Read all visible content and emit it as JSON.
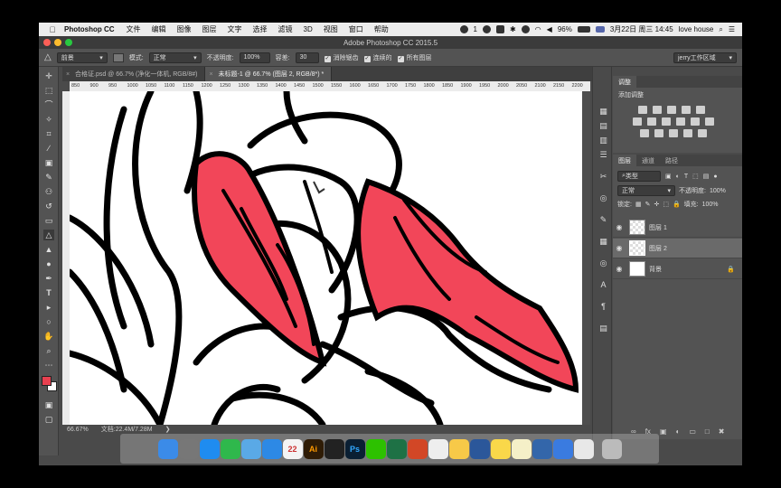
{
  "menubar": {
    "app_name": "Photoshop CC",
    "items": [
      "文件",
      "编辑",
      "图像",
      "图层",
      "文字",
      "选择",
      "滤镜",
      "3D",
      "视图",
      "窗口",
      "帮助"
    ],
    "wechat_count": "1",
    "battery": "96%",
    "datetime": "3月22日 周三 14:45",
    "user": "love house"
  },
  "titlebar": {
    "title": "Adobe Photoshop CC 2015.5"
  },
  "options": {
    "fill_source": "前景",
    "mode_label": "模式:",
    "mode_value": "正常",
    "opacity_label": "不透明度:",
    "opacity_value": "100%",
    "tolerance_label": "容差:",
    "tolerance_value": "30",
    "antialias_label": "消除锯齿",
    "contiguous_label": "连续的",
    "all_layers_label": "所有图层",
    "workspace": "jerry工作区域"
  },
  "tabs": [
    {
      "label": "合格证.psd @ 66.7% (净化一体机, RGB/8#)",
      "active": false
    },
    {
      "label": "未标题-1 @ 66.7% (图层 2, RGB/8*) *",
      "active": true
    }
  ],
  "ruler_ticks": [
    "850",
    "900",
    "950",
    "1000",
    "1050",
    "1100",
    "1150",
    "1200",
    "1250",
    "1300",
    "1350",
    "1400",
    "1450",
    "1500",
    "1550",
    "1600",
    "1650",
    "1700",
    "1750",
    "1800",
    "1850",
    "1900",
    "1950",
    "2000",
    "2050",
    "2100",
    "2150",
    "2200"
  ],
  "status": {
    "zoom": "66.67%",
    "doc": "文档:22.4M/7.28M"
  },
  "adjustments": {
    "title": "调整",
    "add_label": "添加调整"
  },
  "layers_panel": {
    "tabs": [
      "图层",
      "通道",
      "路径"
    ],
    "filter_label": "类型",
    "blend_mode": "正常",
    "opacity_label": "不透明度:",
    "opacity_value": "100%",
    "lock_label": "锁定:",
    "fill_label": "填充:",
    "fill_value": "100%",
    "layers": [
      {
        "name": "图层 1",
        "selected": false
      },
      {
        "name": "图层 2",
        "selected": true
      },
      {
        "name": "背景",
        "selected": false
      }
    ]
  },
  "dock": {
    "apps": [
      {
        "name": "finder",
        "color": "#3b8be8"
      },
      {
        "name": "launchpad",
        "color": "#777"
      },
      {
        "name": "app-store",
        "color": "#1f8cf0"
      },
      {
        "name": "facetime",
        "color": "#2fb84c"
      },
      {
        "name": "qq-browser",
        "color": "#5aa9e6"
      },
      {
        "name": "safari",
        "color": "#2d89e5"
      },
      {
        "name": "calendar",
        "color": "#f4f4f4",
        "label": "22"
      },
      {
        "name": "illustrator",
        "color": "#2f1c06",
        "label": "Ai"
      },
      {
        "name": "qq",
        "color": "#222"
      },
      {
        "name": "photoshop",
        "color": "#0a1f33",
        "label": "Ps"
      },
      {
        "name": "wechat",
        "color": "#2dc100"
      },
      {
        "name": "excel",
        "color": "#1e7145"
      },
      {
        "name": "powerpoint",
        "color": "#d24726"
      },
      {
        "name": "acrobat",
        "color": "#eee"
      },
      {
        "name": "photos",
        "color": "#f7c948"
      },
      {
        "name": "word",
        "color": "#2b579a"
      },
      {
        "name": "stickies",
        "color": "#f9d84a"
      },
      {
        "name": "notes",
        "color": "#f5f0c8"
      },
      {
        "name": "quicktime",
        "color": "#3366aa"
      },
      {
        "name": "baidu-netdisk",
        "color": "#3a7be0"
      },
      {
        "name": "chrome",
        "color": "#e8e8e8"
      },
      {
        "name": "trash",
        "color": "#bbb"
      }
    ]
  },
  "colors": {
    "fill_red": "#f24659",
    "foreground": "#e8404f",
    "background": "#ffffff"
  }
}
